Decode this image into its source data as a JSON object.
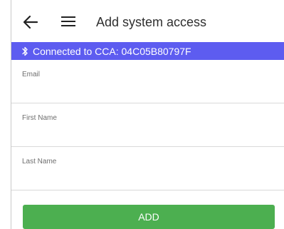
{
  "header": {
    "title": "Add system access",
    "back_icon": "arrow-left-icon",
    "menu_icon": "hamburger-menu-icon"
  },
  "status": {
    "text": "Connected to CCA: 04C05B80797F",
    "icon": "bluetooth-icon",
    "color": "#5d5cf0"
  },
  "form": {
    "email": {
      "label": "Email",
      "value": ""
    },
    "first_name": {
      "label": "First Name",
      "value": ""
    },
    "last_name": {
      "label": "Last Name",
      "value": ""
    }
  },
  "actions": {
    "add_label": "ADD",
    "add_color": "#4caf50"
  }
}
